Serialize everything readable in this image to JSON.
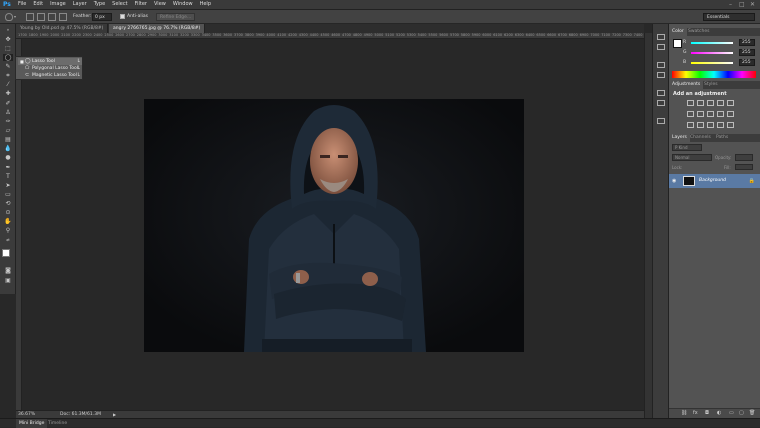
{
  "app": {
    "logo": "Ps"
  },
  "menu": [
    "File",
    "Edit",
    "Image",
    "Layer",
    "Type",
    "Select",
    "Filter",
    "View",
    "Window",
    "Help"
  ],
  "options_bar": {
    "feather_label": "Feather:",
    "feather_value": "0 px",
    "anti_alias_label": "Anti-alias",
    "refine_edge_label": "Refine Edge...",
    "workspace": "Essentials"
  },
  "tabs": [
    {
      "label": "Young by Old.psd @ 47.5% (RGB/8#)",
      "active": false
    },
    {
      "label": "angry 2766765.jpg @ 76.7% (RGB/8#)",
      "active": true
    }
  ],
  "ruler_ticks": [
    "1700",
    "1800",
    "1900",
    "2000",
    "2100",
    "2200",
    "2300",
    "2400",
    "2500",
    "2600",
    "2700",
    "2800",
    "2900",
    "3000",
    "3100",
    "3200",
    "3300",
    "3400",
    "3500",
    "3600",
    "3700",
    "3800",
    "3900",
    "4000",
    "4100",
    "4200",
    "4300",
    "4400",
    "4500",
    "4600",
    "4700",
    "4800",
    "4900",
    "5000",
    "5100",
    "5200",
    "5300",
    "5400",
    "5500",
    "5600",
    "5700",
    "5800",
    "5900",
    "6000",
    "6100",
    "6200",
    "6300",
    "6400",
    "6500",
    "6600",
    "6700",
    "6800",
    "6900",
    "7000",
    "7100",
    "7200",
    "7300",
    "7400"
  ],
  "flyout": [
    {
      "label": "Lasso Tool",
      "key": "L",
      "selected": true
    },
    {
      "label": "Polygonal Lasso Tool",
      "key": "L",
      "selected": false
    },
    {
      "label": "Magnetic Lasso Tool",
      "key": "L",
      "selected": false
    }
  ],
  "status": {
    "zoom": "36.67%",
    "doc": "Doc: 61.3M/61.3M"
  },
  "bottom_tabs": [
    "Mini Bridge",
    "Timeline"
  ],
  "color_panel": {
    "tabs": [
      "Color",
      "Swatches"
    ],
    "channels": [
      {
        "label": "R",
        "value": "255",
        "color": "#ff4040"
      },
      {
        "label": "G",
        "value": "255",
        "color": "#40ff40"
      },
      {
        "label": "B",
        "value": "255",
        "color": "#4060ff"
      }
    ]
  },
  "adjustments_panel": {
    "tabs": [
      "Adjustments",
      "Styles"
    ],
    "heading": "Add an adjustment"
  },
  "layers_panel": {
    "tabs": [
      "Layers",
      "Channels",
      "Paths"
    ],
    "kind_filter": "P Kind",
    "blend_mode": "Normal",
    "opacity_label": "Opacity:",
    "lock_label": "Lock:",
    "fill_label": "Fill:",
    "layer_name": "Background"
  }
}
